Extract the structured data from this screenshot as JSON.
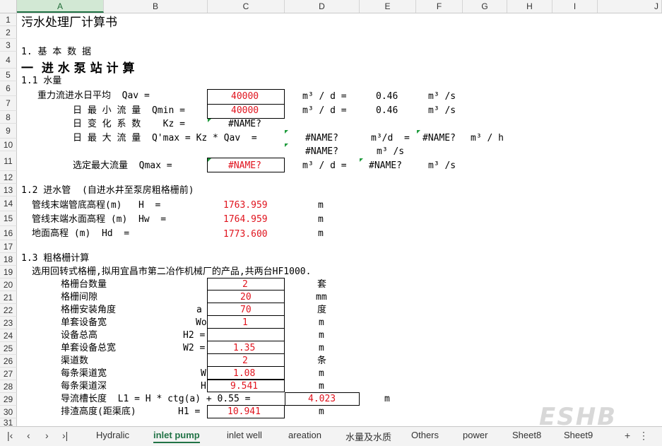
{
  "columns": [
    "A",
    "B",
    "C",
    "D",
    "E",
    "F",
    "G",
    "H",
    "I",
    "J"
  ],
  "rows": [
    "1",
    "2",
    "3",
    "4",
    "5",
    "6",
    "7",
    "8",
    "9",
    "10",
    "11",
    "12",
    "13",
    "14",
    "15",
    "16",
    "17",
    "18",
    "19",
    "20",
    "21",
    "22",
    "23",
    "24",
    "25",
    "26",
    "27",
    "28",
    "29",
    "30",
    "31"
  ],
  "cells": {
    "r1": "污水处理厂计算书",
    "r3": "1. 基 本 数 据",
    "r4": "一  进 水 泵 站 计 算",
    "r5": "1.1 水量",
    "r6_label": "重力流进水日平均  Qav =",
    "r6_val": "40000",
    "r6_unit": "m³ / d =",
    "r6_e": "0.46",
    "r6_f": "m³ /s",
    "r7_label": "日 最 小 流 量  Qmin =",
    "r7_val": "40000",
    "r7_unit": "m³ / d =",
    "r7_e": "0.46",
    "r7_f": "m³ /s",
    "r8_label": "日 变 化 系 数    Kz =",
    "r8_val": "#NAME?",
    "r9_label": "日 最 大 流 量  Q'max = Kz * Qav  =",
    "r9_d": "#NAME?",
    "r9_e": "m³/d  =",
    "r9_f": "#NAME?",
    "r9_g": "m³ / h",
    "r10_d": "#NAME?",
    "r10_e": "m³ /s",
    "r11_label": "选定最大流量  Qmax =",
    "r11_val": "#NAME?",
    "r11_unit": "m³ / d =",
    "r11_e": "#NAME?",
    "r11_f": "m³ /s",
    "r13": "1.2 进水管  (自进水井至泵房粗格栅前)",
    "r14_label": "管线末端管底高程(m)   H  =",
    "r14_val": "1763.959",
    "r14_unit": "m",
    "r15_label": "管线末端水面高程 (m)  Hw  =",
    "r15_val": "1764.959",
    "r15_unit": "m",
    "r16_label": "地面高程 (m)  Hd  =",
    "r16_val": "1773.600",
    "r16_unit": "m",
    "r18": "1.3 粗格栅计算",
    "r19": "选用回转式格栅,拟用宜昌市第二冶作机械厂的产品,共两台HF1000.",
    "r20_label": "格栅台数量",
    "r20_val": "2",
    "r20_unit": "套",
    "r21_label": "格栅间隙",
    "r21_val": "20",
    "r21_unit": "mm",
    "r22_label": "格栅安装角度",
    "r22_sym": "a",
    "r22_val": "70",
    "r22_unit": "度",
    "r23_label": "单套设备宽",
    "r23_sym": "Wo",
    "r23_val": "1",
    "r23_unit": "m",
    "r24_label": "设备总高",
    "r24_sym": "H2 =",
    "r24_unit": "m",
    "r25_label": "单套设备总宽",
    "r25_sym": "W2 =",
    "r25_val": "1.35",
    "r25_unit": "m",
    "r26_label": "渠道数",
    "r26_val": "2",
    "r26_unit": "条",
    "r27_label": "每条渠道宽",
    "r27_sym": "W",
    "r27_val": "1.08",
    "r27_unit": "m",
    "r28_label": "每条渠道深",
    "r28_sym": "H",
    "r28_val": "9.541",
    "r28_unit": "m",
    "r29_label": "导流槽长度  L1 = H * ctg(a) + 0.55 =",
    "r29_val": "4.023",
    "r29_unit": "m",
    "r30_label": "排渣高度(距渠底)",
    "r30_sym": "H1 =",
    "r30_val": "10.941",
    "r30_unit": "m"
  },
  "tabs": [
    "Hydralic",
    "inlet pump",
    "inlet well",
    "areation",
    "水量及水质",
    "Others",
    "power",
    "Sheet8",
    "Sheet9"
  ],
  "active_tab": "inlet pump",
  "watermark": "ESHB",
  "colors": {
    "accent": "#217346",
    "value_red": "#e0141e"
  }
}
